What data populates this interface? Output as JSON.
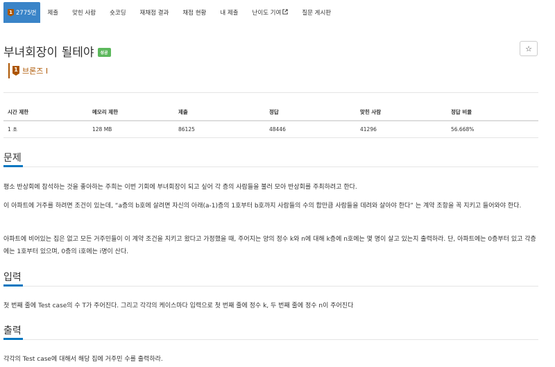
{
  "tabs": [
    {
      "label": "2775번",
      "badge": "1",
      "active": true
    },
    {
      "label": "제출"
    },
    {
      "label": "맞힌 사람"
    },
    {
      "label": "숏코딩"
    },
    {
      "label": "재채점 결과"
    },
    {
      "label": "채점 현황"
    },
    {
      "label": "내 제출"
    },
    {
      "label": "난이도 기여"
    },
    {
      "label": "질문 게시판"
    }
  ],
  "problem": {
    "title": "부녀회장이 될테야",
    "status_badge": "성공",
    "star_glyph": "☆",
    "tier_number": "1",
    "tier_label": "브론즈 I"
  },
  "info_table": {
    "headers": [
      "시간 제한",
      "메모리 제한",
      "제출",
      "정답",
      "맞힌 사람",
      "정답 비율"
    ],
    "row": [
      "1 초",
      "128 MB",
      "86125",
      "48446",
      "41296",
      "56.668%"
    ]
  },
  "sections": {
    "problem": {
      "heading": "문제",
      "p1": "평소 반상회에 참석하는 것을 좋아하는 주희는 이번 기회에 부녀회장이 되고 싶어 각 층의 사람들을 불러 모아 반상회를 주최하려고 한다.",
      "p2": "이 아파트에 거주를 하려면 조건이 있는데, “a층의 b호에 살려면 자신의 아래(a-1)층의 1호부터 b호까지 사람들의 수의 합만큼 사람들을 데려와 살아야 한다” 는 계약 조항을 꼭 지키고 들어와야 한다.",
      "p3": "아파트에 비어있는 집은 없고 모든 거주민들이 이 계약 조건을 지키고 왔다고 가정했을 때, 주어지는 양의 정수 k와 n에 대해 k층에 n호에는 몇 명이 살고 있는지 출력하라. 단, 아파트에는 0층부터 있고 각층에는 1호부터 있으며, 0층의 i호에는 i명이 산다."
    },
    "input": {
      "heading": "입력",
      "p1": "첫 번째 줄에 Test case의 수 T가 주어진다. 그리고 각각의 케이스마다 입력으로 첫 번째 줄에 정수 k, 두 번째 줄에 정수 n이 주어진다"
    },
    "output": {
      "heading": "출력",
      "p1": "각각의 Test case에 대해서 해당 집에 거주민 수를 출력하라."
    }
  },
  "colors": {
    "accent": "#0076c0",
    "active_tab": "#3a84c8",
    "bronze": "#ad5600",
    "success": "#5cb85c"
  }
}
